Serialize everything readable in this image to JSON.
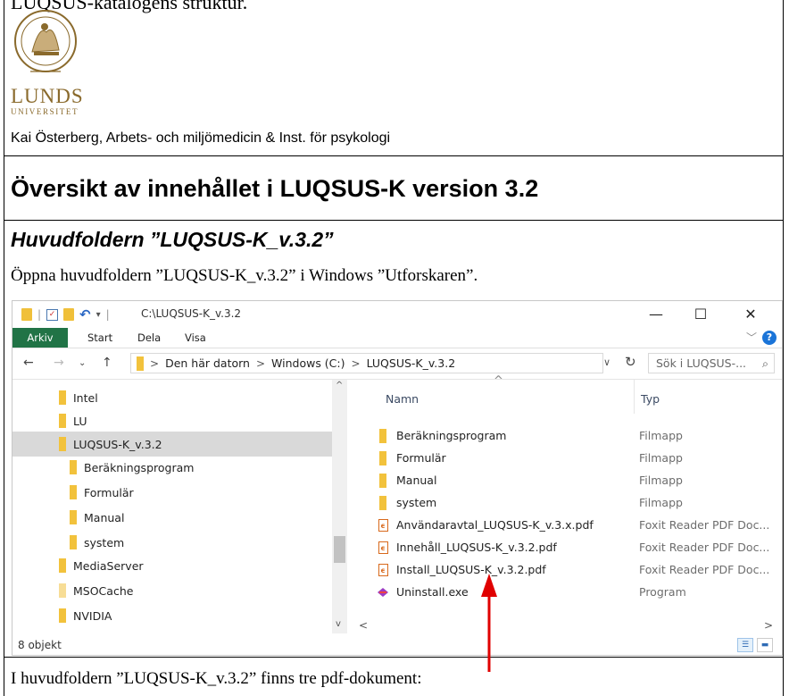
{
  "document": {
    "top_heading_partial": "LUQSUS-katalogens struktur.",
    "logo_line1": "LUNDS",
    "logo_line2": "UNIVERSITET",
    "author": "Kai Österberg, Arbets- och miljömedicin & Inst. för psykologi",
    "title": "Översikt av innehållet i LUQSUS-K version 3.2",
    "subtitle": "Huvudfoldern ”LUQSUS-K_v.3.2”",
    "paragraph1": "Öppna huvudfoldern ”LUQSUS-K_v.3.2” i Windows ”Utforskaren”.",
    "paragraph2": "I huvudfoldern ”LUQSUS-K_v.3.2” finns tre pdf-dokument:"
  },
  "explorer": {
    "title": "C:\\LUQSUS-K_v.3.2",
    "window_buttons": {
      "minimize": "—",
      "maximize": "☐",
      "close": "✕"
    },
    "ribbon_tabs": [
      "Arkiv",
      "Start",
      "Dela",
      "Visa"
    ],
    "help": "?",
    "address": {
      "crumbs": [
        "Den här datorn",
        "Windows (C:)",
        "LUQSUS-K_v.3.2"
      ],
      "search_placeholder": "Sök i LUQSUS-..."
    },
    "nav_items": [
      {
        "label": "Intel",
        "selected": false,
        "indent": 0
      },
      {
        "label": "LU",
        "selected": false,
        "indent": 0
      },
      {
        "label": "LUQSUS-K_v.3.2",
        "selected": true,
        "indent": 0
      },
      {
        "label": "Beräkningsprogram",
        "selected": false,
        "indent": 1
      },
      {
        "label": "Formulär",
        "selected": false,
        "indent": 1
      },
      {
        "label": "Manual",
        "selected": false,
        "indent": 1
      },
      {
        "label": "system",
        "selected": false,
        "indent": 1
      },
      {
        "label": "MediaServer",
        "selected": false,
        "indent": 0
      },
      {
        "label": "MSOCache",
        "selected": false,
        "indent": 0
      },
      {
        "label": "NVIDIA",
        "selected": false,
        "indent": 0
      }
    ],
    "columns": {
      "name": "Namn",
      "type": "Typ"
    },
    "files": [
      {
        "name": "Beräkningsprogram",
        "type": "Filmapp",
        "icon": "folder-icon"
      },
      {
        "name": "Formulär",
        "type": "Filmapp",
        "icon": "folder-icon"
      },
      {
        "name": "Manual",
        "type": "Filmapp",
        "icon": "folder-icon"
      },
      {
        "name": "system",
        "type": "Filmapp",
        "icon": "folder-icon"
      },
      {
        "name": "Användaravtal_LUQSUS-K_v.3.x.pdf",
        "type": "Foxit Reader PDF Doc...",
        "icon": "pdf-icon"
      },
      {
        "name": "Innehåll_LUQSUS-K_v.3.2.pdf",
        "type": "Foxit Reader PDF Doc...",
        "icon": "pdf-icon"
      },
      {
        "name": "Install_LUQSUS-K_v.3.2.pdf",
        "type": "Foxit Reader PDF Doc...",
        "icon": "pdf-icon"
      },
      {
        "name": "Uninstall.exe",
        "type": "Program",
        "icon": "uninstall-icon"
      }
    ],
    "status": "8 objekt"
  },
  "colors": {
    "ribbon_file_tab": "#217346",
    "folder": "#f2c23c",
    "selection": "#d9d9d9",
    "logo": "#8a6a2c",
    "arrow": "#e00000"
  }
}
